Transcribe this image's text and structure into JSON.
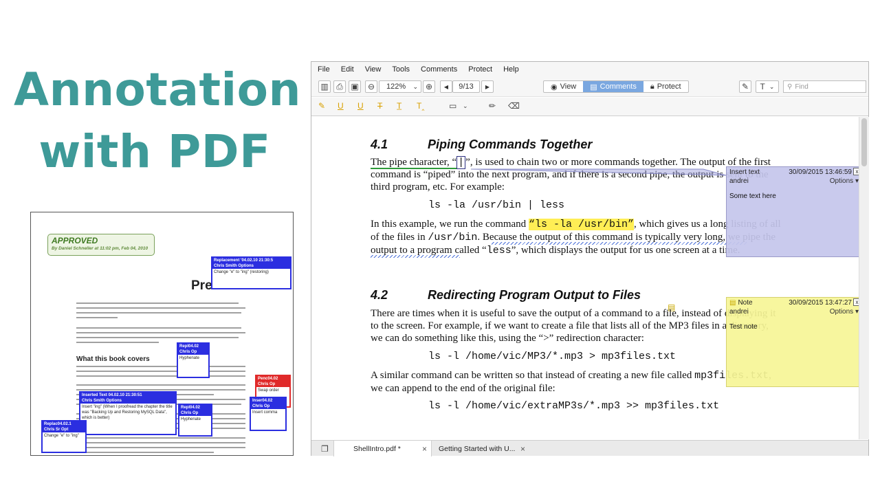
{
  "slide": {
    "title_line1": "Annotation",
    "title_line2": "with PDF"
  },
  "thumbnail": {
    "stamp_title": "APPROVED",
    "stamp_sub": "By Daniel Schneller at 11:02 pm, Feb 04, 2010",
    "heading": "Preface",
    "section": "What this book covers",
    "notes": [
      {
        "head": "Replacement '04.02.10 21:30:5",
        "head2": "Chris Smith  Options",
        "body": "Change \"e\" to \"ing\" (restoring)"
      },
      {
        "head": "Repl04.02",
        "head2": "Chris Op",
        "body": "Hyphenate"
      },
      {
        "head": "Inserted Text  04.02.10 21:30:51",
        "head2": "Chris Smith  Options",
        "body": "Insert \"ing\" (When I proofread the chapter the title was \"Backing Up and Restoring MySQL Data\", which is better)"
      },
      {
        "head": "Repl04.02",
        "head2": "Chris Op",
        "body": "Hyphenate"
      },
      {
        "head": "Replac04.02.1",
        "head2": "Chris Sr  Opt",
        "body": "Change \"e\" to \"ing\""
      },
      {
        "head": "Penc04.02",
        "head2": "Chris Op",
        "body": "Swap order"
      },
      {
        "head": "Inser04.02",
        "head2": "Chris Op",
        "body": "Insert comma"
      }
    ]
  },
  "menu": [
    "File",
    "Edit",
    "View",
    "Tools",
    "Comments",
    "Protect",
    "Help"
  ],
  "toolbar": {
    "zoom": "122%",
    "page": "9/13",
    "modes": [
      "View",
      "Comments",
      "Protect"
    ],
    "find_placeholder": "Find"
  },
  "document": {
    "s41_num": "4.1",
    "s41_title": "Piping Commands Together",
    "p1_a": "The pipe character, “",
    "p1_pipe": "|",
    "p1_b": "”, is used to chain two or more commands together.  The output of the first",
    "p1_l2": "command is “piped” into the next program, and if there is a second pipe, the output is sent to the",
    "p1_l3": "third program, etc.  For example:",
    "code1": "ls -la /usr/bin | less",
    "p2_a": "In this example, we run the command ",
    "p2_code": "“ls -la /usr/bin”",
    "p2_b": ", which gives us a long listing of all",
    "p2_l2a": "of the files in ",
    "p2_l2code": "/usr/bin",
    "p2_l2b": ".  Because the output of this command is typically very long, we pipe the",
    "p2_l3a": "output to a program called “",
    "p2_l3code": "less",
    "p2_l3b": "”, which displays the output for us one screen at a time.",
    "s42_num": "4.2",
    "s42_title": "Redirecting Program Output to Files",
    "p3_l1": "There are times when it is useful to save the output of a command to a file, instead of displaying it",
    "p3_l2": "to the screen.  For example, if we want to create a file that lists all of the MP3 files in a directory,",
    "p3_l3": "we can do something like this, using the “>” redirection character:",
    "code2": "ls -l /home/vic/MP3/*.mp3 > mp3files.txt",
    "p4_l1a": "A similar command can be written so that instead of creating a new file called ",
    "p4_l1code": "mp3files.txt",
    "p4_l1b": ",",
    "p4_l2": "we can append to the end of the original file:",
    "code3": "ls -l /home/vic/extraMP3s/*.mp3 >> mp3files.txt"
  },
  "popups": {
    "insert": {
      "type": "Insert text",
      "date": "30/09/2015 13:46:59",
      "author": "andrei",
      "options": "Options",
      "text": "Some text here",
      "close": "x"
    },
    "note": {
      "type": "Note",
      "date": "30/09/2015 13:47:27",
      "author": "andrei",
      "options": "Options",
      "text": "Test note",
      "close": "x"
    }
  },
  "tabs": [
    {
      "label": "ShellIntro.pdf *",
      "close": "×"
    },
    {
      "label": "Getting Started with U...",
      "close": "×"
    }
  ],
  "colors": {
    "title": "#3e9a98",
    "active_mode": "#7aa7e0",
    "highlight": "#ffee55",
    "annotation_blue": "#2b2ee0"
  }
}
